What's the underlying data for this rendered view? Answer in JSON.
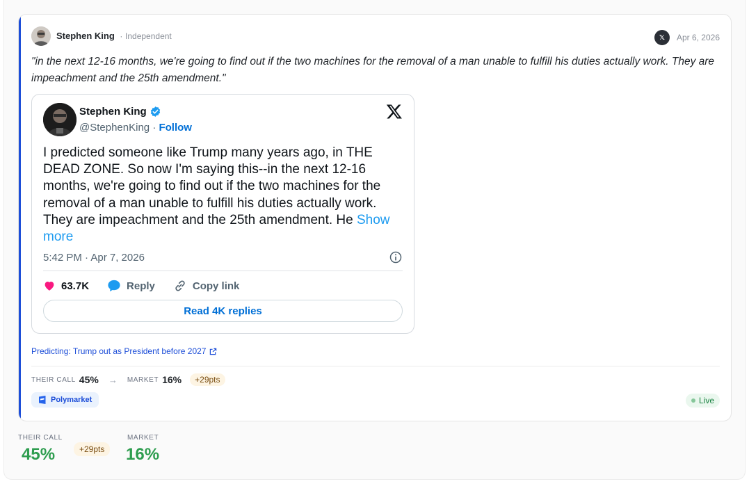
{
  "post": {
    "author": "Stephen King",
    "separator": "·",
    "affiliation": "Independent",
    "source_badge": "𝕏",
    "date": "Apr 6, 2026",
    "quote": "\"in the next 12-16 months, we're going to find out if the two machines for the removal of a man unable to fulfill his duties actually work. They are impeachment and the 25th amendment.\""
  },
  "tweet": {
    "name": "Stephen King",
    "handle": "@StephenKing",
    "dot": "·",
    "follow": "Follow",
    "text": "I predicted someone like Trump many years ago, in THE DEAD ZONE. So now  I'm saying this--in the next 12-16 months, we're going to find out if  the two machines for the removal of a man unable to fulfill his duties  actually work. They are impeachment and the 25th amendment. He ",
    "show_more": "Show more",
    "time": "5:42 PM · Apr 7, 2026",
    "likes": "63.7K",
    "reply": "Reply",
    "copy_link": "Copy link",
    "read_replies": "Read 4K replies"
  },
  "prediction": {
    "label": "Predicting: Trump out as President before 2027",
    "their_call_label": "THEIR CALL",
    "their_call": "45%",
    "arrow": "→",
    "market_label": "MARKET",
    "market": "16%",
    "diff": "+29pts",
    "platform": "Polymarket",
    "status": "Live"
  },
  "summary": {
    "their_call_label": "THEIR CALL",
    "their_call": "45%",
    "diff": "+29pts",
    "market_label": "MARKET",
    "market": "16%"
  },
  "colors": {
    "accent": "#1d4ed8",
    "positive": "#2e9d4f",
    "like": "#f91880",
    "twitter_blue": "#1d9bf0"
  },
  "icons": [
    "x-logo-icon",
    "verified-icon",
    "heart-icon",
    "reply-icon",
    "link-icon",
    "info-icon",
    "external-link-icon",
    "polymarket-icon"
  ]
}
